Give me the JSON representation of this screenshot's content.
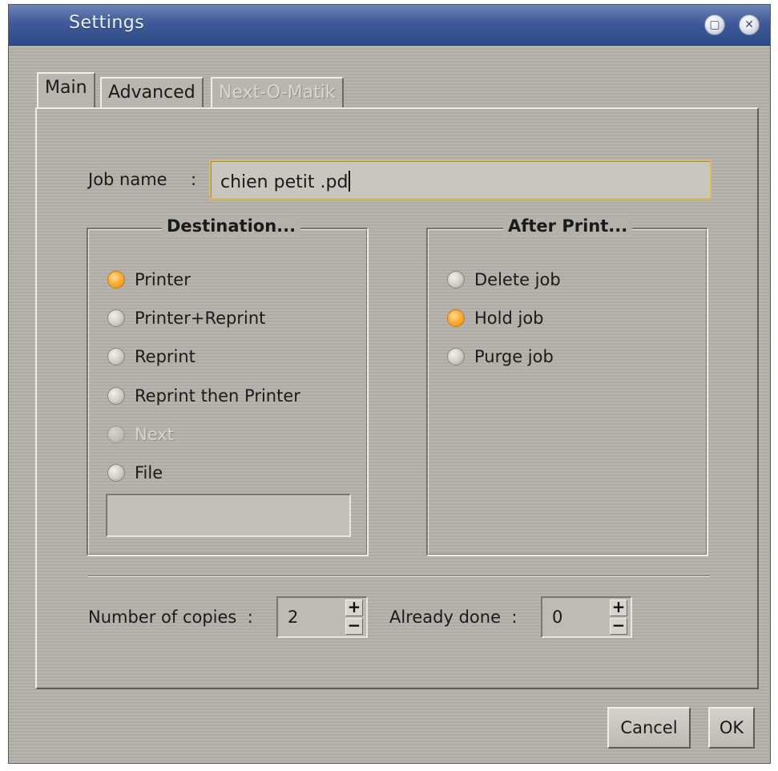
{
  "window": {
    "title": "Settings",
    "controls": {
      "maximize_icon": "maximize-icon",
      "close_icon": "close-icon"
    }
  },
  "tabs": [
    {
      "label": "Main",
      "active": true,
      "enabled": true
    },
    {
      "label": "Advanced",
      "active": false,
      "enabled": true
    },
    {
      "label": "Next-O-Matik",
      "active": false,
      "enabled": false
    }
  ],
  "job": {
    "label": "Job name",
    "separator": ":",
    "value": "chien petit .pd"
  },
  "destination": {
    "title": "Destination...",
    "options": [
      {
        "label": "Printer",
        "checked": true,
        "enabled": true
      },
      {
        "label": "Printer+Reprint",
        "checked": false,
        "enabled": true
      },
      {
        "label": "Reprint",
        "checked": false,
        "enabled": true
      },
      {
        "label": "Reprint then Printer",
        "checked": false,
        "enabled": true
      },
      {
        "label": "Next",
        "checked": false,
        "enabled": false
      },
      {
        "label": "File",
        "checked": false,
        "enabled": true
      }
    ],
    "file_path": ""
  },
  "after_print": {
    "title": "After Print...",
    "options": [
      {
        "label": "Delete job",
        "checked": false
      },
      {
        "label": "Hold job",
        "checked": true
      },
      {
        "label": "Purge job",
        "checked": false
      }
    ]
  },
  "copies": {
    "label": "Number of copies",
    "separator": ":",
    "value": "2",
    "up": "+",
    "down": "−"
  },
  "already_done": {
    "label": "Already done",
    "separator": ":",
    "value": "0",
    "up": "+",
    "down": "−"
  },
  "buttons": {
    "cancel": "Cancel",
    "ok": "OK"
  },
  "colors": {
    "titlebar": "#3f5a97",
    "radio_checked": "#fbb23e",
    "input_focus_border": "#e2b85c",
    "background": "#b4b1aa"
  }
}
